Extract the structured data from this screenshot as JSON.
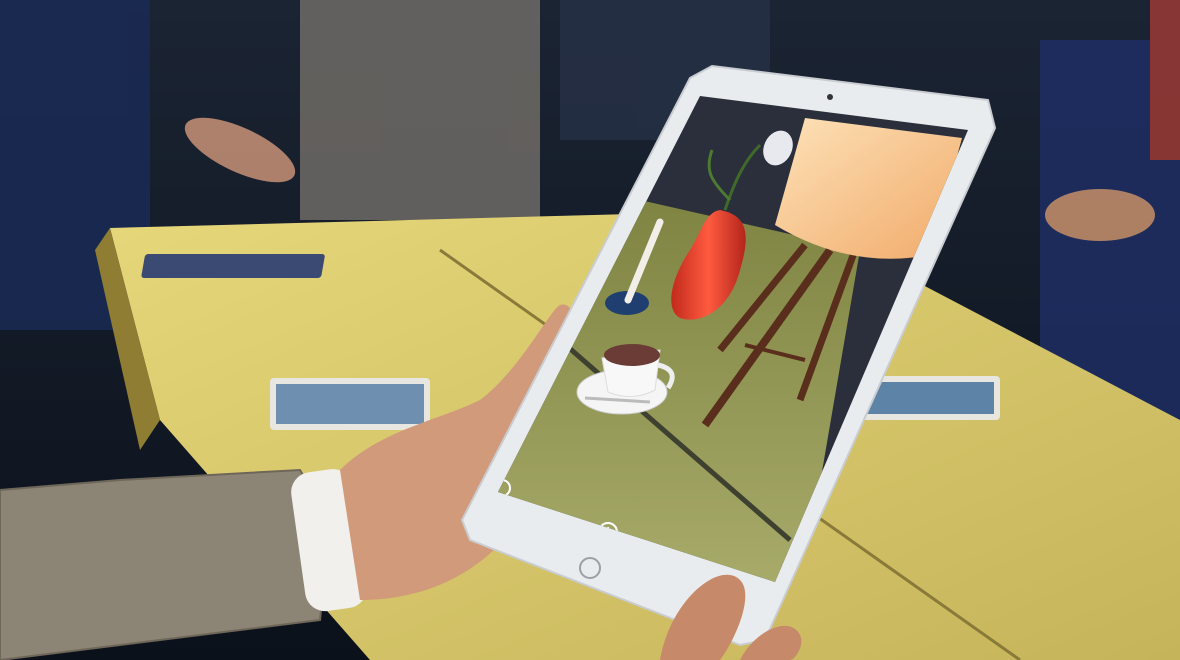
{
  "scene": {
    "subject": "ipad-ar-demo",
    "colors": {
      "background_dark": "#0d1420",
      "table_yellow": "#d9c96a",
      "ipad_frame": "#eef0f2",
      "ar_floor": "#9a9e58",
      "ar_wall": "#2a2f3b",
      "lamp_shade": "#f7c890",
      "vase_red": "#d83a2a",
      "sweater": "#8c8576",
      "skin": "#d19a7a"
    },
    "icons": [
      "home-button-icon",
      "camera-icon",
      "add-icon",
      "record-icon"
    ]
  }
}
